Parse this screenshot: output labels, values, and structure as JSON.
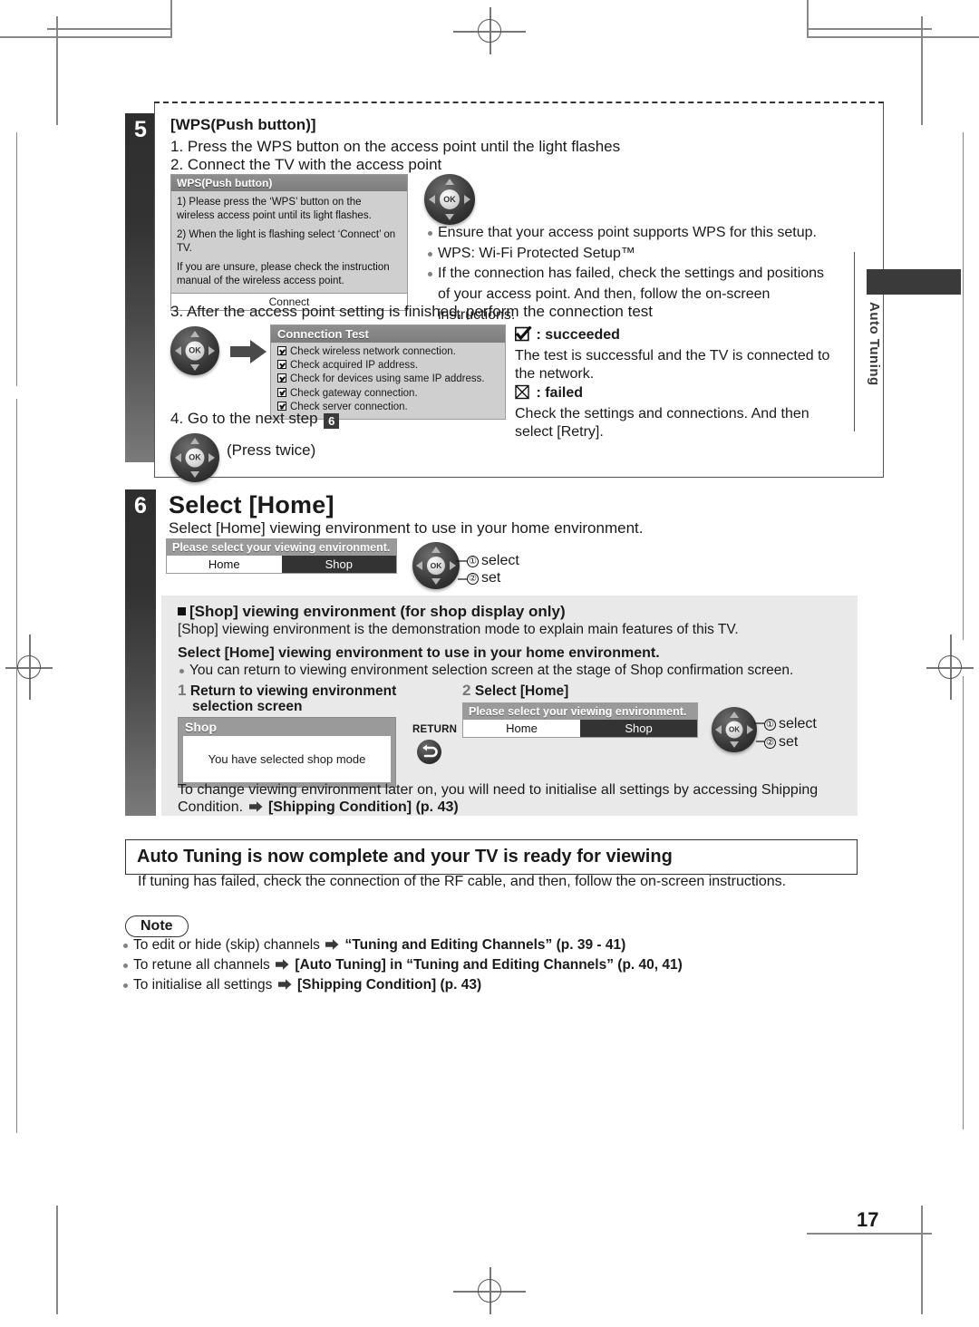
{
  "page": {
    "number": "17",
    "side_tab_label": "Auto Tuning"
  },
  "step5": {
    "badge": "5",
    "heading": "[WPS(Push button)]",
    "line1": "1. Press the WPS button on the access point until the light flashes",
    "line2": "2. Connect the TV with the access point",
    "wps_dialog": {
      "title": "WPS(Push button)",
      "p1": "1) Please press the ‘WPS’ button on the wireless access point until its light flashes.",
      "p2": "2) When the light is flashing select ‘Connect’ on TV.",
      "p3": "If you are unsure, please check the instruction manual of the wireless access point.",
      "button": "Connect"
    },
    "notes": [
      "Ensure that your access point supports WPS for this setup.",
      "WPS: Wi-Fi Protected Setup™",
      "If the connection has failed, check the settings and positions of your access point. And then, follow the on-screen instructions."
    ],
    "line3": "3. After the access point setting is finished, perform the connection test",
    "connection_test": {
      "title": "Connection Test",
      "items": [
        "Check wireless network connection.",
        "Check acquired IP address.",
        "Check for devices using same IP address.",
        "Check gateway connection.",
        "Check server connection."
      ]
    },
    "line4_pre": "4. Go to the next step",
    "line4_step": "6",
    "press_twice": "(Press twice)",
    "succeeded_label": ": succeeded",
    "succeeded_text": "The test is successful and the TV is connected to the network.",
    "failed_label": ": failed",
    "failed_text": "Check the settings and connections. And then select [Retry]."
  },
  "step6": {
    "badge": "6",
    "title": "Select [Home]",
    "subtitle": "Select [Home] viewing environment to use in your home environment.",
    "ve_dialog": {
      "head": "Please select your viewing environment.",
      "home": "Home",
      "shop": "Shop"
    },
    "dpad_hint_1": "select",
    "dpad_hint_2": "set",
    "dpad_num_1": "①",
    "dpad_num_2": "②",
    "shop_section": {
      "heading": "[Shop] viewing environment (for shop display only)",
      "desc": "[Shop] viewing environment is the demonstration mode to explain main features of this TV.",
      "bold_line": "Select [Home] viewing environment to use in your home environment.",
      "bullet": "You can return to viewing environment selection screen at the stage of Shop confirmation screen.",
      "item1_num": "1",
      "item1_label_l1": "Return to viewing environment",
      "item1_label_l2": "selection screen",
      "item2_num": "2",
      "item2_label": "Select [Home]",
      "shop_dialog_title": "Shop",
      "shop_dialog_body": "You have selected shop mode",
      "return_label": "RETURN",
      "footer_a": "To change viewing environment later on, you will need to initialise all settings by accessing Shipping",
      "footer_b_pre": "Condition.",
      "footer_b_bold": "[Shipping Condition] (p. 43)"
    }
  },
  "banner": {
    "text": "Auto Tuning is now complete and your TV is ready for viewing"
  },
  "after_banner": "If tuning has failed, check the connection of the RF cable, and then, follow the on-screen instructions.",
  "note": {
    "pill": "Note",
    "items": [
      {
        "plain": "To edit or hide (skip) channels",
        "bold": "“Tuning and Editing Channels” (p. 39 - 41)"
      },
      {
        "plain": "To retune all channels",
        "bold": "[Auto Tuning] in “Tuning and Editing Channels” (p. 40, 41)"
      },
      {
        "plain": "To initialise all settings",
        "bold": "[Shipping Condition] (p. 43)"
      }
    ]
  }
}
